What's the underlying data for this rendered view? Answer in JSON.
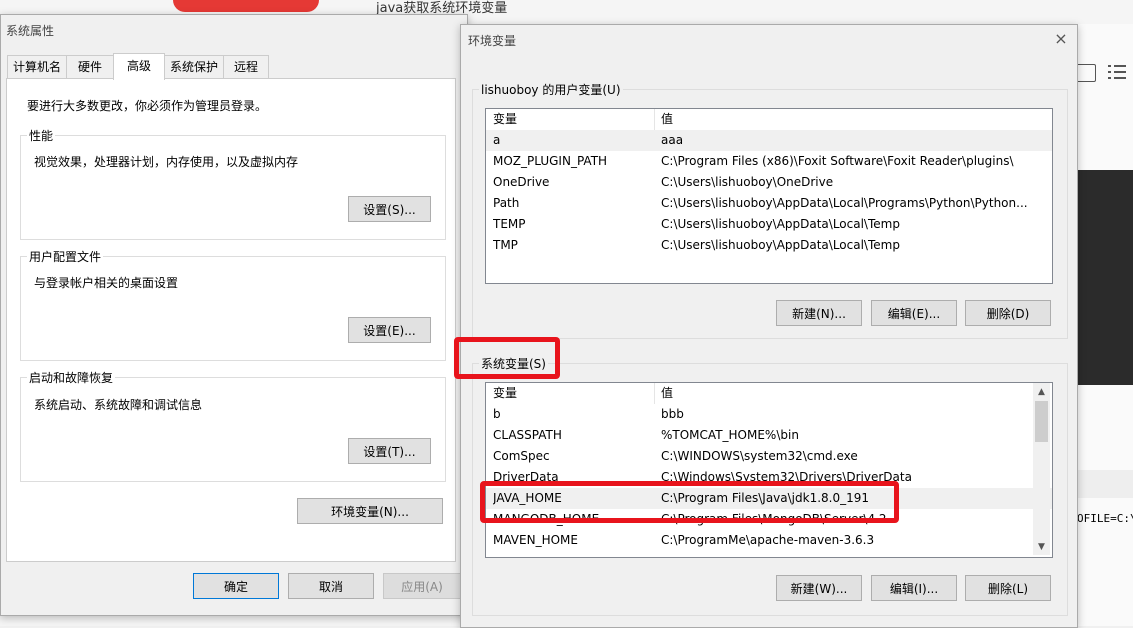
{
  "background": {
    "article_title": "java获取系统环境变量",
    "code_fragment": "OFILE=C:\\"
  },
  "sysprops": {
    "title": "系统属性",
    "tabs": [
      "计算机名",
      "硬件",
      "高级",
      "系统保护",
      "远程"
    ],
    "admin_note": "要进行大多数更改，你必须作为管理员登录。",
    "performance": {
      "legend": "性能",
      "desc": "视觉效果，处理器计划，内存使用，以及虚拟内存",
      "button": "设置(S)..."
    },
    "profile": {
      "legend": "用户配置文件",
      "desc": "与登录帐户相关的桌面设置",
      "button": "设置(E)..."
    },
    "startup": {
      "legend": "启动和故障恢复",
      "desc": "系统启动、系统故障和调试信息",
      "button": "设置(T)..."
    },
    "env_button": "环境变量(N)...",
    "ok": "确定",
    "cancel": "取消",
    "apply": "应用(A)"
  },
  "envvars": {
    "title": "环境变量",
    "user_section": {
      "legend": "lishuoboy 的用户变量(U)",
      "col_var": "变量",
      "col_val": "值",
      "rows": [
        {
          "name": "a",
          "value": "aaa"
        },
        {
          "name": "MOZ_PLUGIN_PATH",
          "value": "C:\\Program Files (x86)\\Foxit Software\\Foxit Reader\\plugins\\"
        },
        {
          "name": "OneDrive",
          "value": "C:\\Users\\lishuoboy\\OneDrive"
        },
        {
          "name": "Path",
          "value": "C:\\Users\\lishuoboy\\AppData\\Local\\Programs\\Python\\Python..."
        },
        {
          "name": "TEMP",
          "value": "C:\\Users\\lishuoboy\\AppData\\Local\\Temp"
        },
        {
          "name": "TMP",
          "value": "C:\\Users\\lishuoboy\\AppData\\Local\\Temp"
        }
      ],
      "new_btn": "新建(N)...",
      "edit_btn": "编辑(E)...",
      "delete_btn": "删除(D)"
    },
    "system_section": {
      "legend": "系统变量(S)",
      "col_var": "变量",
      "col_val": "值",
      "rows": [
        {
          "name": "b",
          "value": "bbb"
        },
        {
          "name": "CLASSPATH",
          "value": "%TOMCAT_HOME%\\bin"
        },
        {
          "name": "ComSpec",
          "value": "C:\\WINDOWS\\system32\\cmd.exe"
        },
        {
          "name": "DriverData",
          "value": "C:\\Windows\\System32\\Drivers\\DriverData"
        },
        {
          "name": "JAVA_HOME",
          "value": "C:\\Program Files\\Java\\jdk1.8.0_191"
        },
        {
          "name": "MANGODB_HOME",
          "value": "C:\\Program Files\\MongoDB\\Server\\4.2"
        },
        {
          "name": "MAVEN_HOME",
          "value": "C:\\ProgramMe\\apache-maven-3.6.3"
        }
      ],
      "new_btn": "新建(W)...",
      "edit_btn": "编辑(I)...",
      "delete_btn": "删除(L)"
    }
  },
  "colors": {
    "highlight": "#e8141c",
    "accent": "#0078d7"
  }
}
